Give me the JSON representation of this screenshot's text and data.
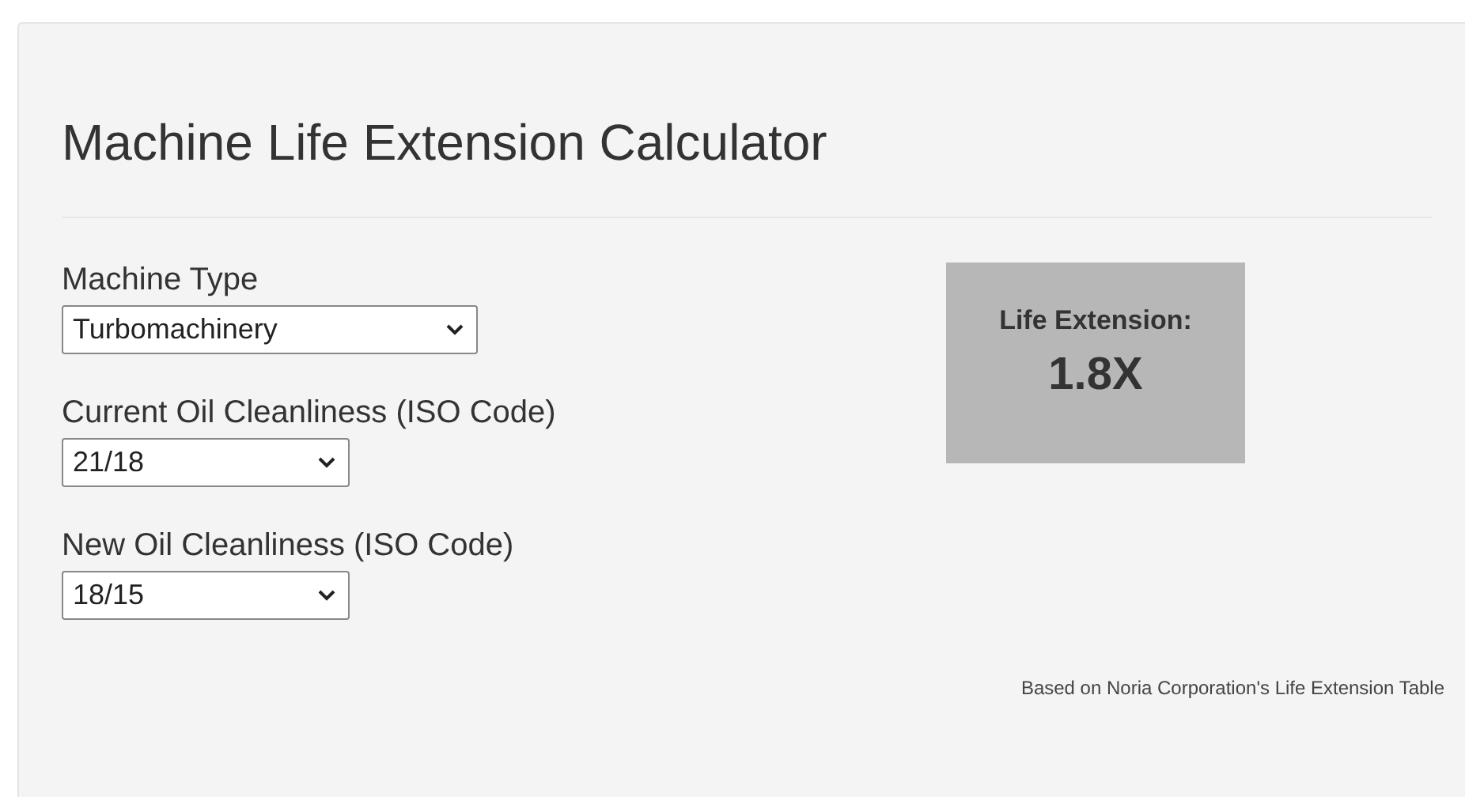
{
  "title": "Machine Life Extension Calculator",
  "fields": [
    {
      "label": "Machine Type",
      "value": "Turbomachinery",
      "kind": "wide"
    },
    {
      "label": "Current Oil Cleanliness (ISO Code)",
      "value": "21/18",
      "kind": "narrow"
    },
    {
      "label": "New Oil Cleanliness (ISO Code)",
      "value": "18/15",
      "kind": "narrow"
    }
  ],
  "result": {
    "label": "Life Extension:",
    "value": "1.8X"
  },
  "footnote": "Based on Noria Corporation's Life Extension Table"
}
